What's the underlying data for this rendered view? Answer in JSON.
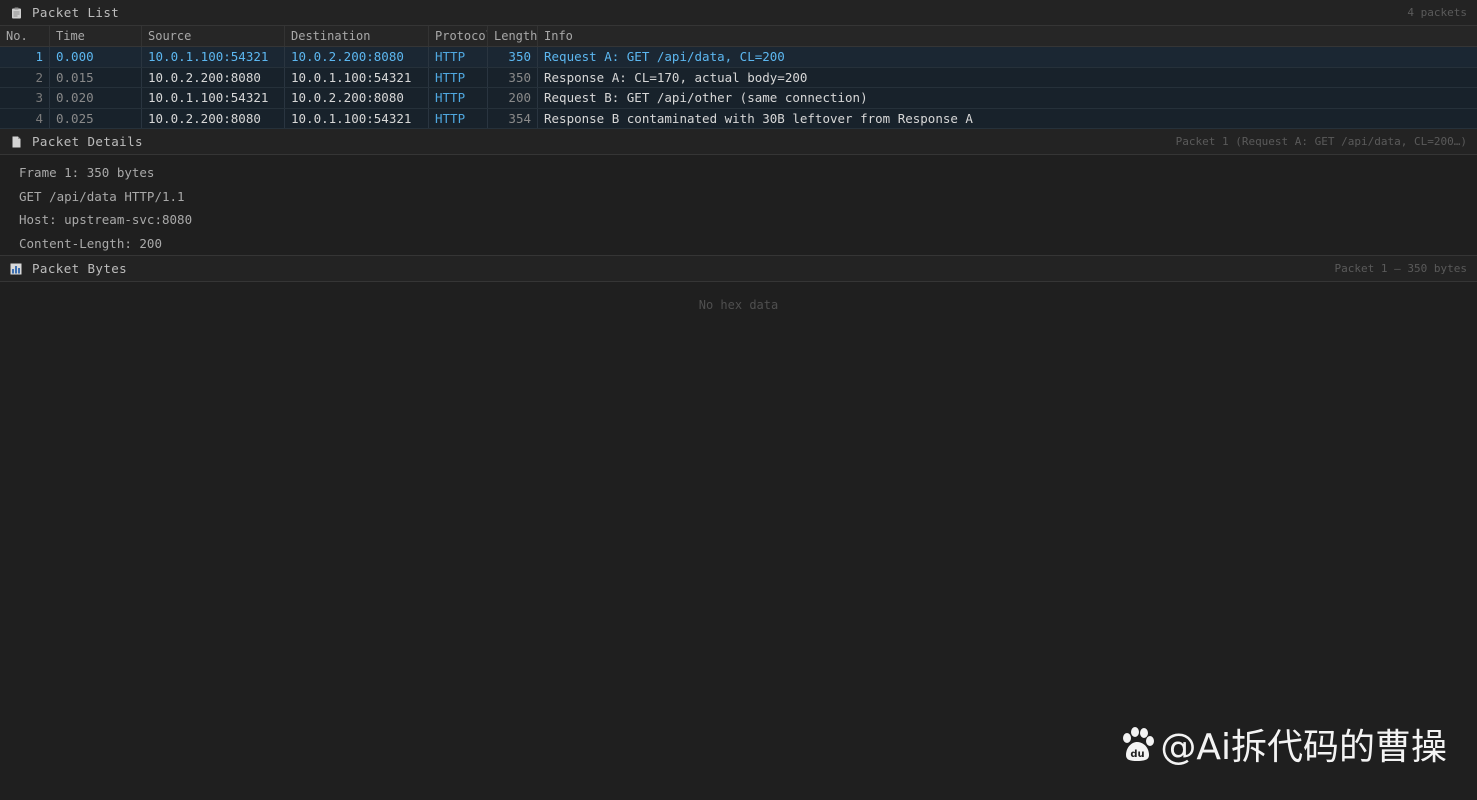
{
  "packet_list": {
    "title": "Packet List",
    "count_label": "4 packets",
    "icon": "clipboard-icon",
    "columns": [
      "No.",
      "Time",
      "Source",
      "Destination",
      "Protocol",
      "Length",
      "Info"
    ],
    "rows": [
      {
        "no": "1",
        "time": "0.000",
        "source": "10.0.1.100:54321",
        "destination": "10.0.2.200:8080",
        "protocol": "HTTP",
        "length": "350",
        "info": "Request A: GET /api/data, CL=200"
      },
      {
        "no": "2",
        "time": "0.015",
        "source": "10.0.2.200:8080",
        "destination": "10.0.1.100:54321",
        "protocol": "HTTP",
        "length": "350",
        "info": "Response A: CL=170, actual body=200"
      },
      {
        "no": "3",
        "time": "0.020",
        "source": "10.0.1.100:54321",
        "destination": "10.0.2.200:8080",
        "protocol": "HTTP",
        "length": "200",
        "info": "Request B: GET /api/other (same connection)"
      },
      {
        "no": "4",
        "time": "0.025",
        "source": "10.0.2.200:8080",
        "destination": "10.0.1.100:54321",
        "protocol": "HTTP",
        "length": "354",
        "info": "Response B contaminated with 30B leftover from Response A"
      }
    ]
  },
  "packet_details": {
    "title": "Packet Details",
    "meta": "Packet 1 (Request A: GET /api/data, CL=200…)",
    "icon": "document-icon",
    "lines": [
      "Frame 1: 350 bytes",
      "GET /api/data HTTP/1.1",
      "Host: upstream-svc:8080",
      "Content-Length: 200"
    ]
  },
  "packet_bytes": {
    "title": "Packet Bytes",
    "meta": "Packet 1 — 350 bytes",
    "icon": "bar-chart-icon",
    "empty_text": "No hex data"
  },
  "watermark": {
    "text": "@Ai拆代码的曹操",
    "icon": "baidu-paw-icon"
  },
  "colors": {
    "background": "#1f1f1f",
    "selected_text": "#5cb7f0",
    "protocol": "#4fa8e0"
  }
}
